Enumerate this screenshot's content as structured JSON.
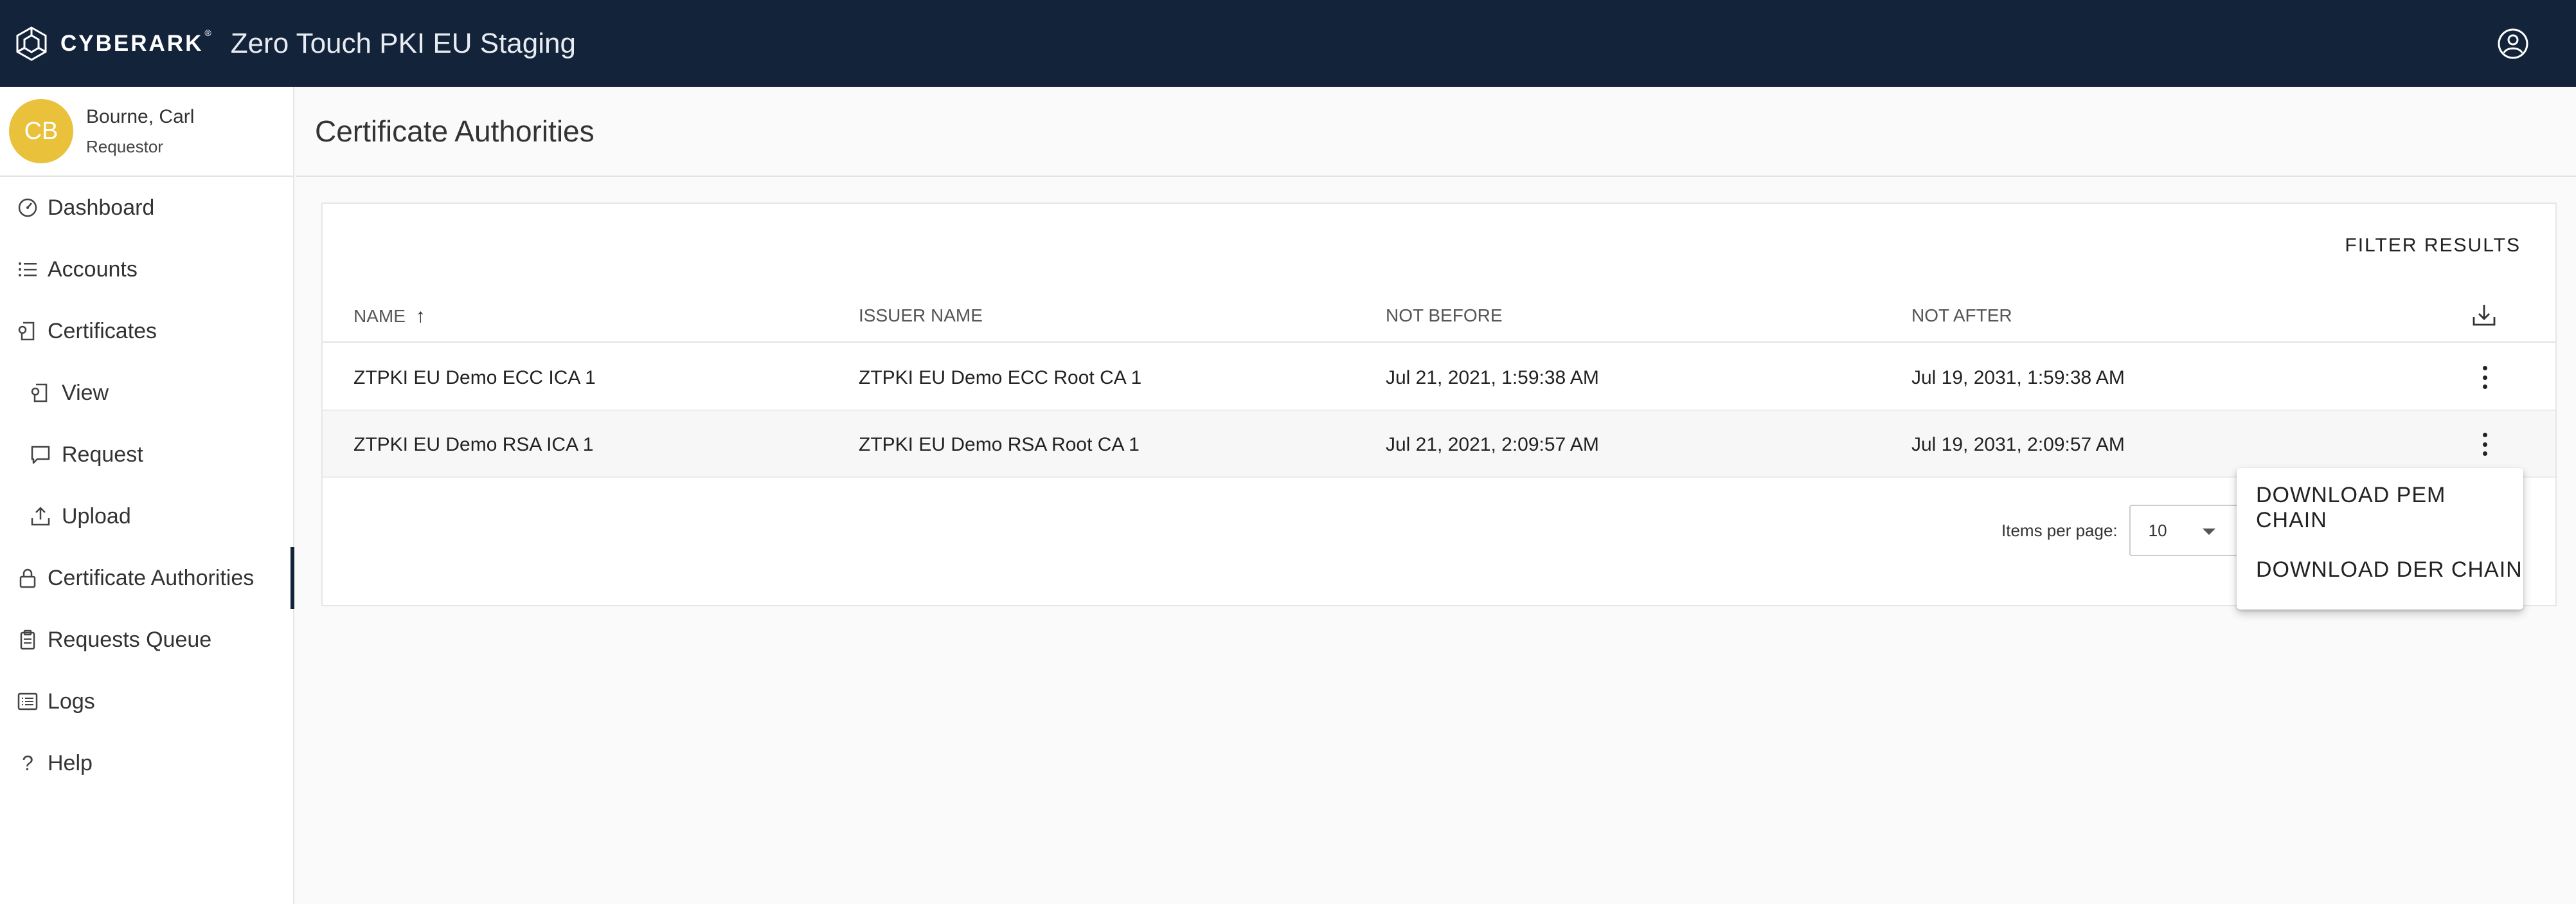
{
  "header": {
    "brand": "CYBERARK",
    "brand_mark": "®",
    "app_title": "Zero Touch PKI EU Staging",
    "account_icon": "account-circle-icon"
  },
  "user": {
    "initials": "CB",
    "name": "Bourne, Carl",
    "role": "Requestor",
    "avatar_color": "#e9c13b"
  },
  "sidebar": {
    "items": [
      {
        "label": "Dashboard",
        "icon": "dashboard-icon"
      },
      {
        "label": "Accounts",
        "icon": "list-icon"
      },
      {
        "label": "Certificates",
        "icon": "certificate-icon"
      },
      {
        "label": "View",
        "icon": "certificate-view-icon"
      },
      {
        "label": "Request",
        "icon": "chat-bubble-icon"
      },
      {
        "label": "Upload",
        "icon": "upload-icon"
      },
      {
        "label": "Certificate Authorities",
        "icon": "lock-icon",
        "active": true
      },
      {
        "label": "Requests Queue",
        "icon": "clipboard-icon"
      },
      {
        "label": "Logs",
        "icon": "logs-icon"
      },
      {
        "label": "Help",
        "icon": "question-icon"
      }
    ]
  },
  "page": {
    "title": "Certificate Authorities"
  },
  "table": {
    "filter_label": "FILTER RESULTS",
    "columns": [
      "NAME",
      "ISSUER NAME",
      "NOT BEFORE",
      "NOT AFTER"
    ],
    "sort_indicator": "↑",
    "rows": [
      [
        "ZTPKI EU Demo ECC ICA 1",
        "ZTPKI EU Demo ECC Root CA 1",
        "Jul 21, 2021, 1:59:38 AM",
        "Jul 19, 2031, 1:59:38 AM"
      ],
      [
        "ZTPKI EU Demo RSA ICA 1",
        "ZTPKI EU Demo RSA Root CA 1",
        "Jul 21, 2021, 2:09:57 AM",
        "Jul 19, 2031, 2:09:57 AM"
      ]
    ],
    "pager": {
      "label": "Items per page:",
      "value": "10"
    }
  },
  "context_menu": {
    "items": [
      "DOWNLOAD PEM CHAIN",
      "DOWNLOAD DER CHAIN"
    ]
  },
  "colors": {
    "topbar": "#13233a",
    "active_indicator": "#13233a"
  }
}
